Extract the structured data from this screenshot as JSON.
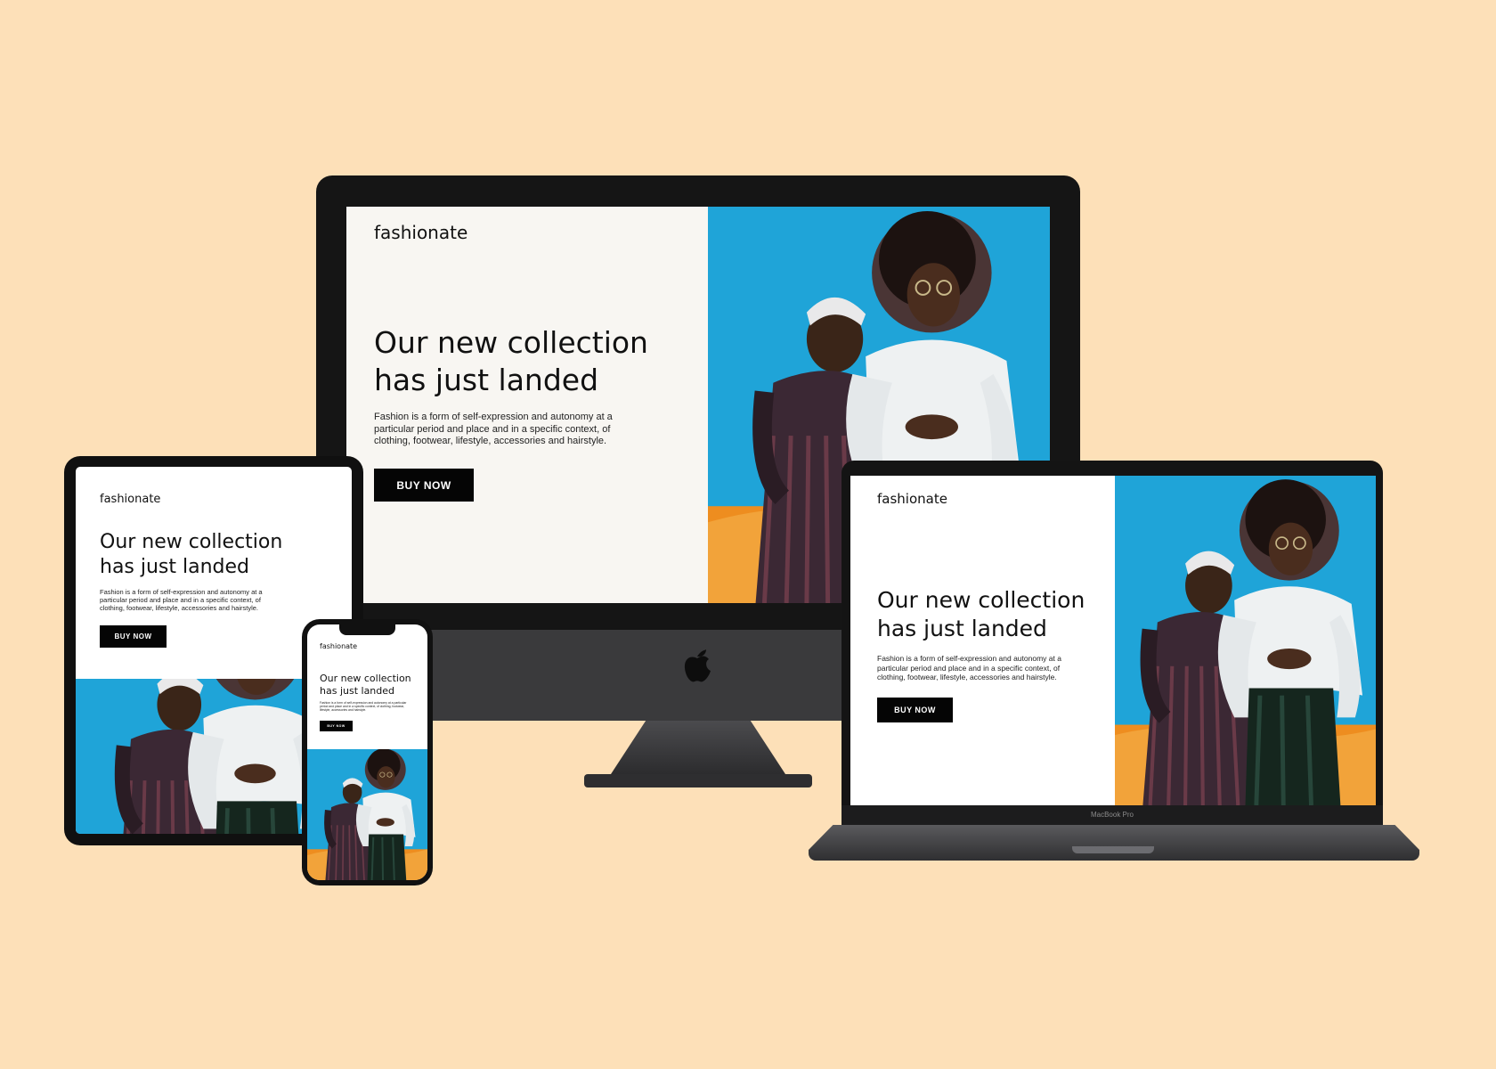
{
  "site": {
    "brand": "fashionate",
    "headline_line1": "Our new collection",
    "headline_line2": "has just landed",
    "description": "Fashion is a form of self-expression and autonomy at a particular period and place and in a specific context, of clothing, footwear, lifestyle, accessories and hairstyle.",
    "cta_label": "BUY NOW"
  },
  "devices": {
    "laptop_model_label": "MacBook Pro"
  },
  "colors": {
    "background": "#fde0b8",
    "sky": "#1fa4d8",
    "accent_orange": "#ee8d1f",
    "button": "#050505"
  }
}
